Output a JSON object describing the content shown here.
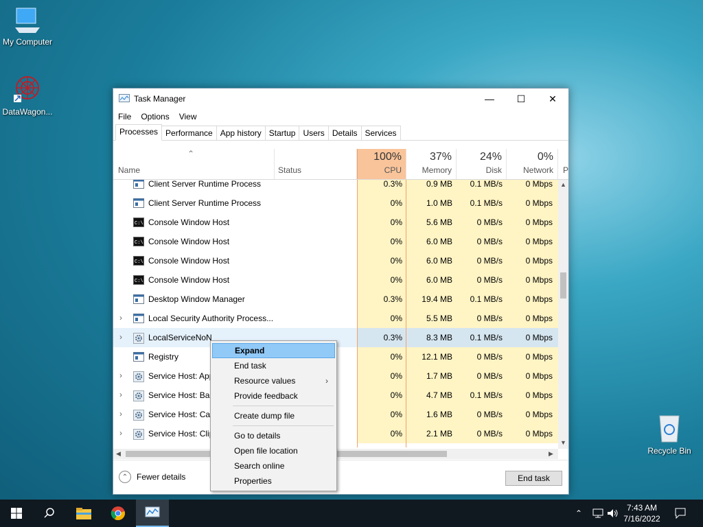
{
  "desktop": {
    "icons": [
      {
        "label": "My Computer",
        "icon": "computer-icon"
      },
      {
        "label": "DataWagon...",
        "icon": "datawagon-icon"
      },
      {
        "label": "Recycle Bin",
        "icon": "recycle-bin-icon"
      }
    ]
  },
  "window": {
    "title": "Task Manager",
    "menu": [
      "File",
      "Options",
      "View"
    ],
    "tabs": [
      "Processes",
      "Performance",
      "App history",
      "Startup",
      "Users",
      "Details",
      "Services"
    ],
    "active_tab": "Processes",
    "columns": {
      "name": "Name",
      "status": "Status",
      "cpu": {
        "pct": "100%",
        "label": "CPU"
      },
      "memory": {
        "pct": "37%",
        "label": "Memory"
      },
      "disk": {
        "pct": "24%",
        "label": "Disk"
      },
      "network": {
        "pct": "0%",
        "label": "Network"
      },
      "power_partial": "P"
    },
    "rows": [
      {
        "name": "Client Server Runtime Process",
        "cpu": "0.3%",
        "mem": "0.9 MB",
        "disk": "0.1 MB/s",
        "net": "0 Mbps",
        "icon": "app-icon",
        "expandable": false
      },
      {
        "name": "Client Server Runtime Process",
        "cpu": "0%",
        "mem": "1.0 MB",
        "disk": "0.1 MB/s",
        "net": "0 Mbps",
        "icon": "app-icon",
        "expandable": false
      },
      {
        "name": "Console Window Host",
        "cpu": "0%",
        "mem": "5.6 MB",
        "disk": "0 MB/s",
        "net": "0 Mbps",
        "icon": "console-icon",
        "expandable": false
      },
      {
        "name": "Console Window Host",
        "cpu": "0%",
        "mem": "6.0 MB",
        "disk": "0 MB/s",
        "net": "0 Mbps",
        "icon": "console-icon",
        "expandable": false
      },
      {
        "name": "Console Window Host",
        "cpu": "0%",
        "mem": "6.0 MB",
        "disk": "0 MB/s",
        "net": "0 Mbps",
        "icon": "console-icon",
        "expandable": false
      },
      {
        "name": "Console Window Host",
        "cpu": "0%",
        "mem": "6.0 MB",
        "disk": "0 MB/s",
        "net": "0 Mbps",
        "icon": "console-icon",
        "expandable": false
      },
      {
        "name": "Desktop Window Manager",
        "cpu": "0.3%",
        "mem": "19.4 MB",
        "disk": "0.1 MB/s",
        "net": "0 Mbps",
        "icon": "app-icon",
        "expandable": false
      },
      {
        "name": "Local Security Authority Process...",
        "cpu": "0%",
        "mem": "5.5 MB",
        "disk": "0 MB/s",
        "net": "0 Mbps",
        "icon": "app-icon",
        "expandable": true
      },
      {
        "name": "LocalServiceNoN",
        "cpu": "0.3%",
        "mem": "8.3 MB",
        "disk": "0.1 MB/s",
        "net": "0 Mbps",
        "icon": "gear-icon",
        "expandable": true,
        "selected": true
      },
      {
        "name": "Registry",
        "cpu": "0%",
        "mem": "12.1 MB",
        "disk": "0 MB/s",
        "net": "0 Mbps",
        "icon": "app-icon",
        "expandable": false
      },
      {
        "name": "Service Host: App",
        "cpu": "0%",
        "mem": "1.7 MB",
        "disk": "0 MB/s",
        "net": "0 Mbps",
        "icon": "gear-icon",
        "expandable": true
      },
      {
        "name": "Service Host: Bac",
        "cpu": "0%",
        "mem": "4.7 MB",
        "disk": "0.1 MB/s",
        "net": "0 Mbps",
        "icon": "gear-icon",
        "expandable": true
      },
      {
        "name": "Service Host: Cap",
        "cpu": "0%",
        "mem": "1.6 MB",
        "disk": "0 MB/s",
        "net": "0 Mbps",
        "icon": "gear-icon",
        "expandable": true
      },
      {
        "name": "Service Host: Clip",
        "cpu": "0%",
        "mem": "2.1 MB",
        "disk": "0 MB/s",
        "net": "0 Mbps",
        "icon": "gear-icon",
        "expandable": true
      }
    ],
    "footer": {
      "fewer_details": "Fewer details",
      "end_task": "End task"
    }
  },
  "context_menu": {
    "items": [
      {
        "label": "Expand",
        "highlighted": true
      },
      {
        "label": "End task"
      },
      {
        "label": "Resource values",
        "submenu": true
      },
      {
        "label": "Provide feedback"
      },
      {
        "separator": true
      },
      {
        "label": "Create dump file"
      },
      {
        "separator": true
      },
      {
        "label": "Go to details"
      },
      {
        "label": "Open file location"
      },
      {
        "label": "Search online"
      },
      {
        "label": "Properties"
      }
    ]
  },
  "taskbar": {
    "time": "7:43 AM",
    "date": "7/16/2022"
  }
}
